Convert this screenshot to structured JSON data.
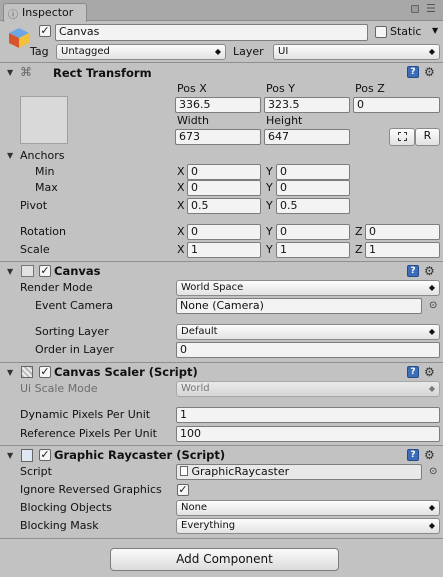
{
  "tab": {
    "title": "Inspector"
  },
  "header": {
    "active_checked": true,
    "name_value": "Canvas",
    "static_label": "Static",
    "tag_label": "Tag",
    "tag_value": "Untagged",
    "layer_label": "Layer",
    "layer_value": "UI"
  },
  "rect_transform": {
    "title": "Rect Transform",
    "pos_x_label": "Pos X",
    "pos_y_label": "Pos Y",
    "pos_z_label": "Pos Z",
    "pos_x": "336.5",
    "pos_y": "323.5",
    "pos_z": "0",
    "width_label": "Width",
    "height_label": "Height",
    "width": "673",
    "height": "647",
    "raw_edit_label": "R",
    "anchors_label": "Anchors",
    "min_label": "Min",
    "max_label": "Max",
    "min_x": "0",
    "min_y": "0",
    "max_x": "0",
    "max_y": "0",
    "pivot_label": "Pivot",
    "pivot_x": "0.5",
    "pivot_y": "0.5",
    "rotation_label": "Rotation",
    "rot_x": "0",
    "rot_y": "0",
    "rot_z": "0",
    "scale_label": "Scale",
    "scale_x": "1",
    "scale_y": "1",
    "scale_z": "1",
    "x": "X",
    "y": "Y",
    "z": "Z"
  },
  "canvas": {
    "title": "Canvas",
    "enabled": true,
    "render_mode_label": "Render Mode",
    "render_mode_value": "World Space",
    "event_camera_label": "Event Camera",
    "event_camera_value": "None (Camera)",
    "sorting_layer_label": "Sorting Layer",
    "sorting_layer_value": "Default",
    "order_label": "Order in Layer",
    "order_value": "0"
  },
  "canvas_scaler": {
    "title": "Canvas Scaler (Script)",
    "enabled": true,
    "ui_scale_mode_label": "Ui Scale Mode",
    "ui_scale_mode_value": "World",
    "dynamic_label": "Dynamic Pixels Per Unit",
    "dynamic_value": "1",
    "reference_label": "Reference Pixels Per Unit",
    "reference_value": "100"
  },
  "raycaster": {
    "title": "Graphic Raycaster (Script)",
    "enabled": true,
    "script_label": "Script",
    "script_value": "GraphicRaycaster",
    "ignore_label": "Ignore Reversed Graphics",
    "ignore_checked": true,
    "blocking_objects_label": "Blocking Objects",
    "blocking_objects_value": "None",
    "blocking_mask_label": "Blocking Mask",
    "blocking_mask_value": "Everything"
  },
  "add_component_label": "Add Component",
  "colors": {
    "background": "#c2c2c2",
    "help_icon": "#3b6db8",
    "tab_bg": "#d8d8d8"
  },
  "icons": [
    "cube-icon",
    "rect-transform-icon",
    "canvas-icon",
    "script-icon",
    "help-icon",
    "gear-icon",
    "lock-icon",
    "menu-icon"
  ]
}
